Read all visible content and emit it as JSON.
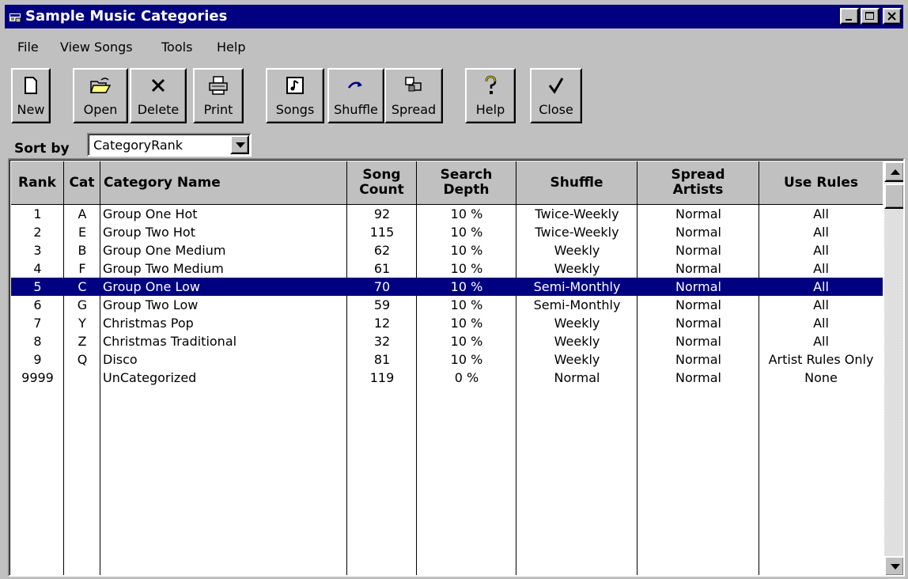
{
  "window": {
    "title": "Sample Music Categories"
  },
  "menu": [
    "File",
    "View Songs",
    "Tools",
    "Help"
  ],
  "toolbar": {
    "new": "New",
    "open": "Open",
    "delete": "Delete",
    "print": "Print",
    "songs": "Songs",
    "shuffle": "Shuffle",
    "spread": "Spread",
    "help": "Help",
    "close": "Close"
  },
  "sort": {
    "label": "Sort by",
    "value": "CategoryRank"
  },
  "grid": {
    "headers": {
      "rank": "Rank",
      "cat": "Cat",
      "name": "Category Name",
      "count_1": "Song",
      "count_2": "Count",
      "depth_1": "Search",
      "depth_2": "Depth",
      "shuffle": "Shuffle",
      "spread_1": "Spread",
      "spread_2": "Artists",
      "rules": "Use Rules"
    },
    "rows": [
      [
        "1",
        "A",
        "Group One Hot",
        "92",
        "10 %",
        "Twice-Weekly",
        "Normal",
        "All"
      ],
      [
        "2",
        "E",
        "Group Two Hot",
        "115",
        "10 %",
        "Twice-Weekly",
        "Normal",
        "All"
      ],
      [
        "3",
        "B",
        "Group One Medium",
        "62",
        "10 %",
        "Weekly",
        "Normal",
        "All"
      ],
      [
        "4",
        "F",
        "Group Two Medium",
        "61",
        "10 %",
        "Weekly",
        "Normal",
        "All"
      ],
      [
        "5",
        "C",
        "Group One Low",
        "70",
        "10 %",
        "Semi-Monthly",
        "Normal",
        "All"
      ],
      [
        "6",
        "G",
        "Group Two Low",
        "59",
        "10 %",
        "Semi-Monthly",
        "Normal",
        "All"
      ],
      [
        "7",
        "Y",
        "Christmas Pop",
        "12",
        "10 %",
        "Weekly",
        "Normal",
        "All"
      ],
      [
        "8",
        "Z",
        "Christmas Traditional",
        "32",
        "10 %",
        "Weekly",
        "Normal",
        "All"
      ],
      [
        "9",
        "Q",
        "Disco",
        "81",
        "10 %",
        "Weekly",
        "Normal",
        "Artist Rules Only"
      ],
      [
        "9999",
        "",
        "UnCategorized",
        "119",
        "0 %",
        "Normal",
        "Normal",
        "None"
      ]
    ],
    "selected_row": 4
  },
  "colors": {
    "titlebar": "#000080",
    "selection": "#000080",
    "face": "#c0c0c0"
  },
  "icons": [
    "app-icon",
    "minimize-icon",
    "maximize-icon",
    "close-icon",
    "new-document-icon",
    "open-folder-icon",
    "delete-x-icon",
    "printer-icon",
    "music-note-icon",
    "shuffle-arrow-icon",
    "spread-icon",
    "question-mark-icon",
    "checkmark-icon",
    "dropdown-arrow-icon",
    "scroll-up-icon",
    "scroll-down-icon"
  ]
}
